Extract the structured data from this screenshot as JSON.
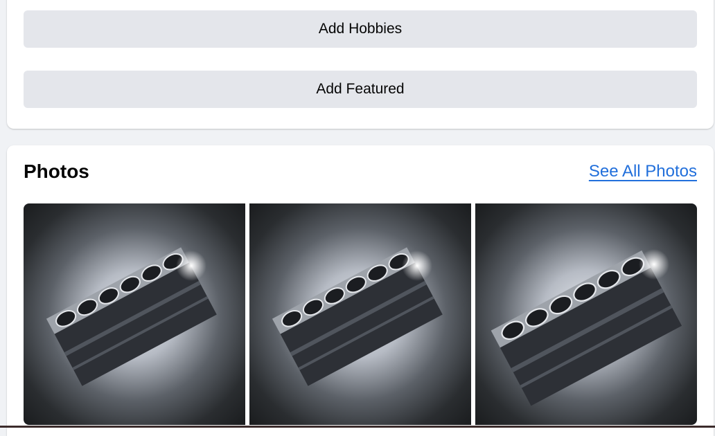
{
  "buttons": {
    "add_hobbies": "Add Hobbies",
    "add_featured": "Add Featured"
  },
  "photos": {
    "title": "Photos",
    "see_all": "See All Photos",
    "items": [
      {
        "subject": "engine-block-image"
      },
      {
        "subject": "engine-block-image"
      },
      {
        "subject": "engine-block-image"
      }
    ]
  },
  "colors": {
    "page_bg": "#f0f2f5",
    "button_bg": "#e4e6eb",
    "link": "#216fdb"
  }
}
